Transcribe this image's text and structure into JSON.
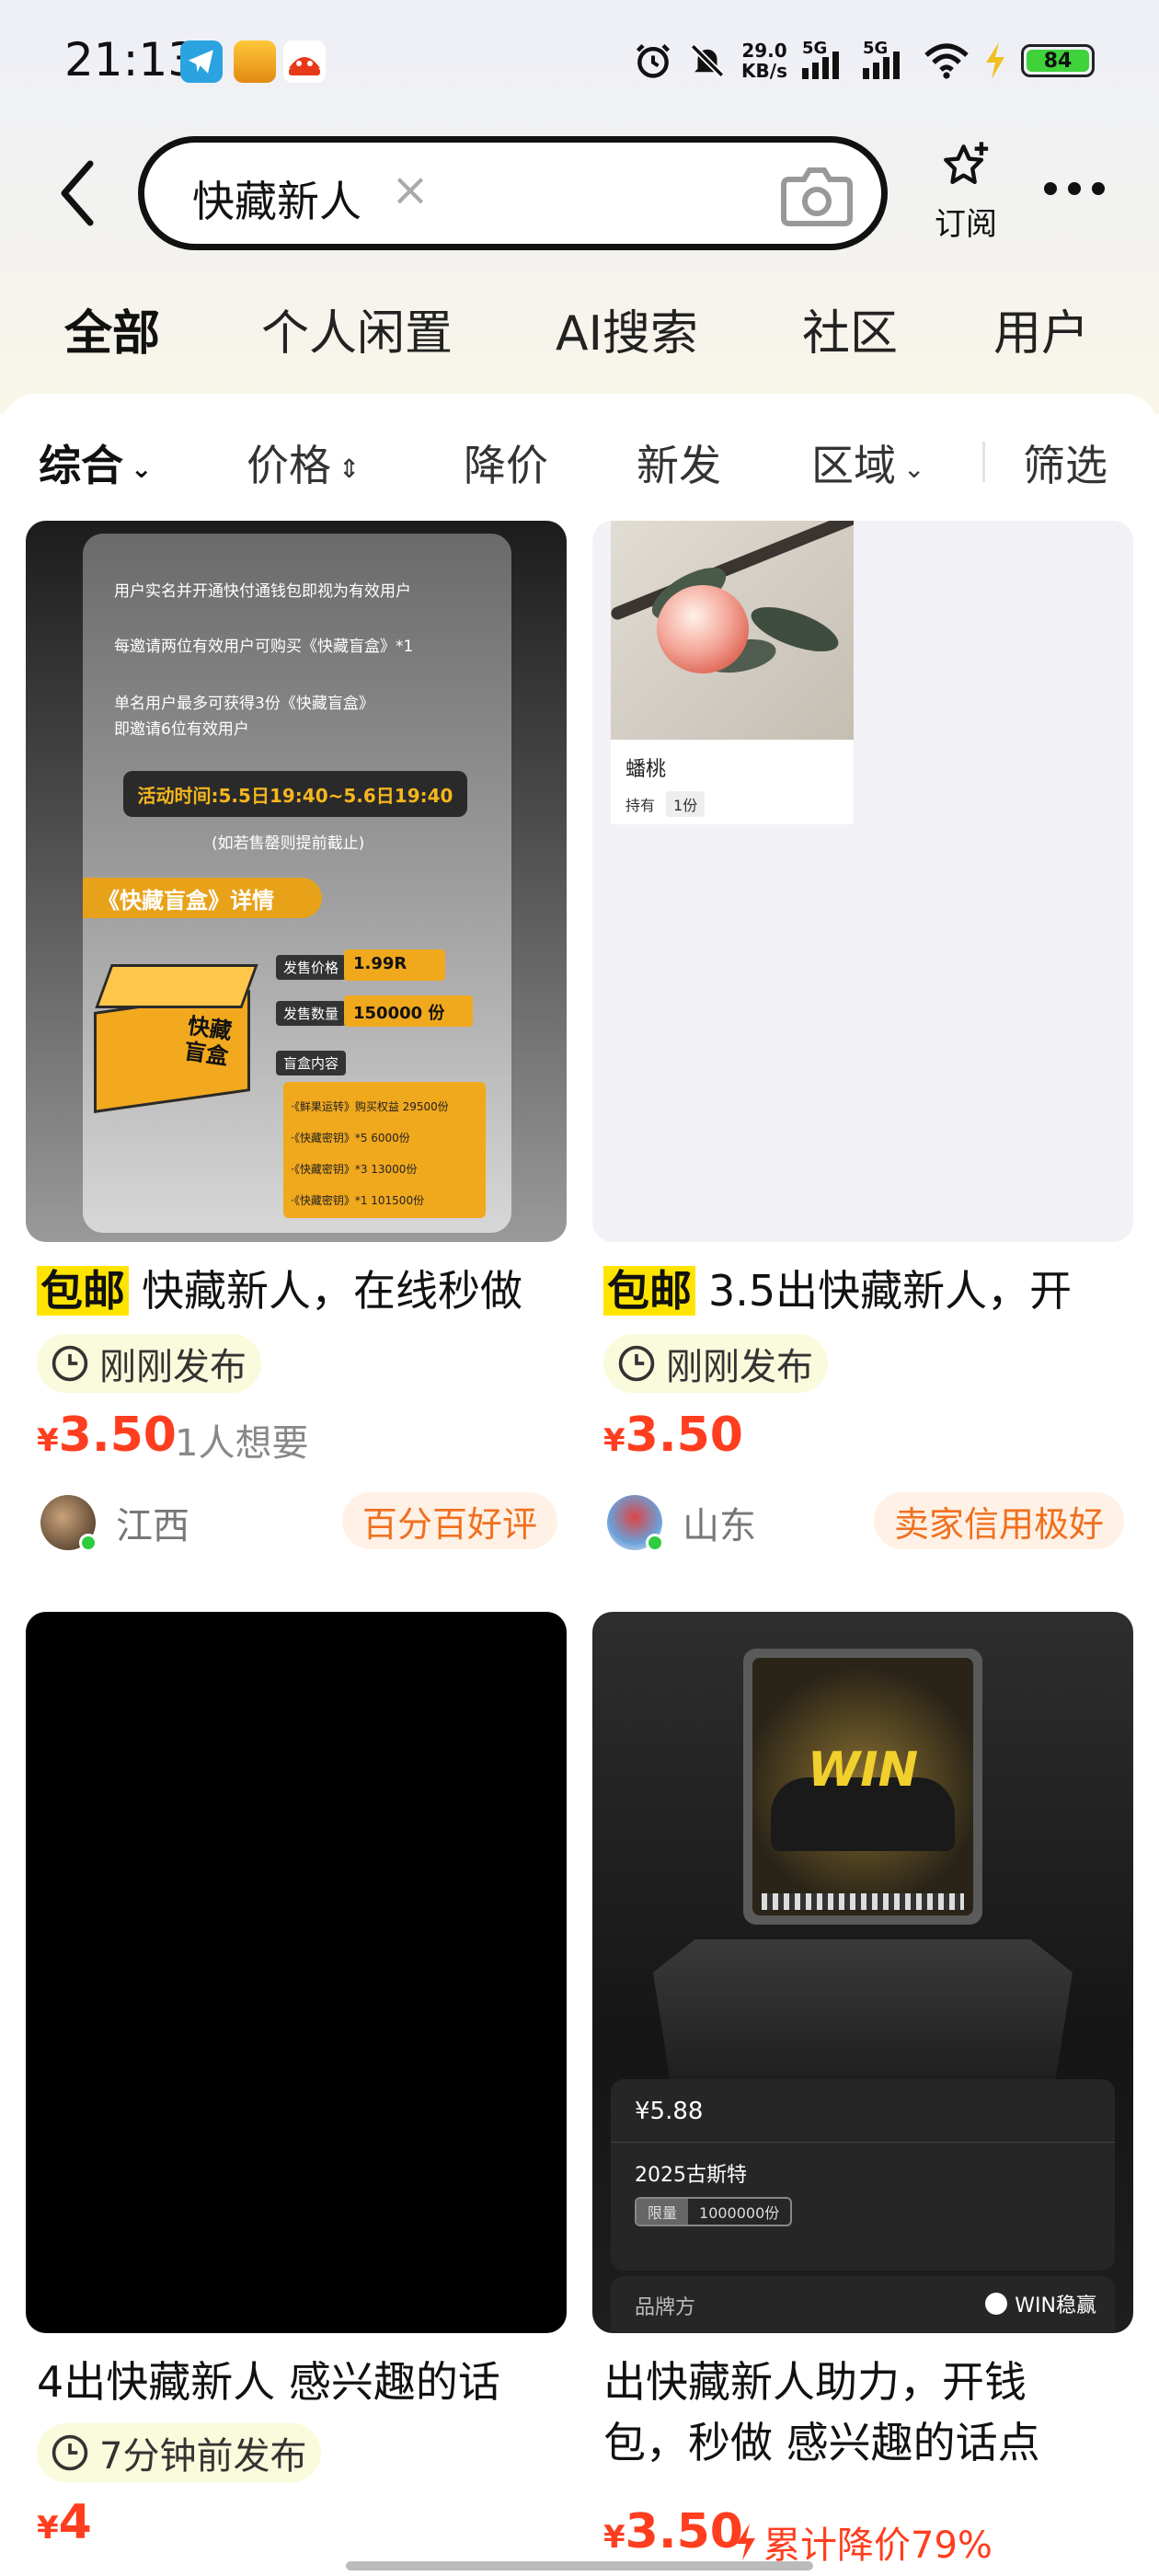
{
  "status_bar": {
    "time": "21:13",
    "net_speed_value": "29.0",
    "net_speed_unit": "KB/s",
    "sim1": "5G",
    "sim2": "5G",
    "battery": "84"
  },
  "search": {
    "query": "快藏新人",
    "clear": "×"
  },
  "header": {
    "subscribe_label": "订阅"
  },
  "tabs": [
    {
      "label": "全部",
      "active": true
    },
    {
      "label": "个人闲置"
    },
    {
      "label": "AI搜索"
    },
    {
      "label": "社区"
    },
    {
      "label": "用户"
    }
  ],
  "filters": {
    "sort": "综合",
    "price": "价格",
    "price_drop": "降价",
    "new": "新发",
    "region": "区域",
    "filter": "筛选"
  },
  "cards": [
    {
      "badge": "包邮",
      "title": "快藏新人，在线秒做",
      "published": "刚刚发布",
      "price_symbol": "¥",
      "price": "3.50",
      "wants": "1人想要",
      "location": "江西",
      "tag": "百分百好评",
      "image": {
        "line1": "用户实名并开通快付通钱包即视为有效用户",
        "line2": "每邀请两位有效用户可购买《快藏盲盒》*1",
        "line3": "单名用户最多可获得3份《快藏盲盒》",
        "line4": "即邀请6位有效用户",
        "time_banner": "活动时间:5.5日19:40~5.6日19:40",
        "note": "(如若售罄则提前截止)",
        "detail_title": "《快藏盲盒》详情",
        "box_label": "快藏盲盒",
        "price_label": "发售价格",
        "price_value": "1.99R",
        "count_label": "发售数量",
        "count_value": "150000 份",
        "contents_label": "盲盒内容",
        "contents": [
          "·《鲜果运转》购买权益 29500份",
          "·《快藏密钥》*5 6000份",
          "·《快藏密钥》*3 13000份",
          "·《快藏密钥》*1 101500份"
        ]
      }
    },
    {
      "badge": "包邮",
      "title": "3.5出快藏新人，开",
      "published": "刚刚发布",
      "price_symbol": "¥",
      "price": "3.50",
      "location": "山东",
      "tag": "卖家信用极好",
      "image": {
        "item_name": "蟠桃",
        "holding_label": "持有",
        "holding_value": "1份"
      }
    },
    {
      "title": "4出快藏新人 感兴趣的话",
      "published": "7分钟前发布",
      "price_symbol": "¥",
      "price": "4"
    },
    {
      "title_line1": "出快藏新人助力，开钱",
      "title_line2": "包，秒做 感兴趣的话点",
      "price_symbol": "¥",
      "price": "3.50",
      "price_drop": "累计降价79%",
      "image": {
        "price": "¥5.88",
        "name": "2025古斯特",
        "limit_label": "限量",
        "limit_value": "1000000份",
        "brand_label": "品牌方",
        "brand_name": "WIN稳赢",
        "logo_text": "WIN"
      }
    }
  ]
}
